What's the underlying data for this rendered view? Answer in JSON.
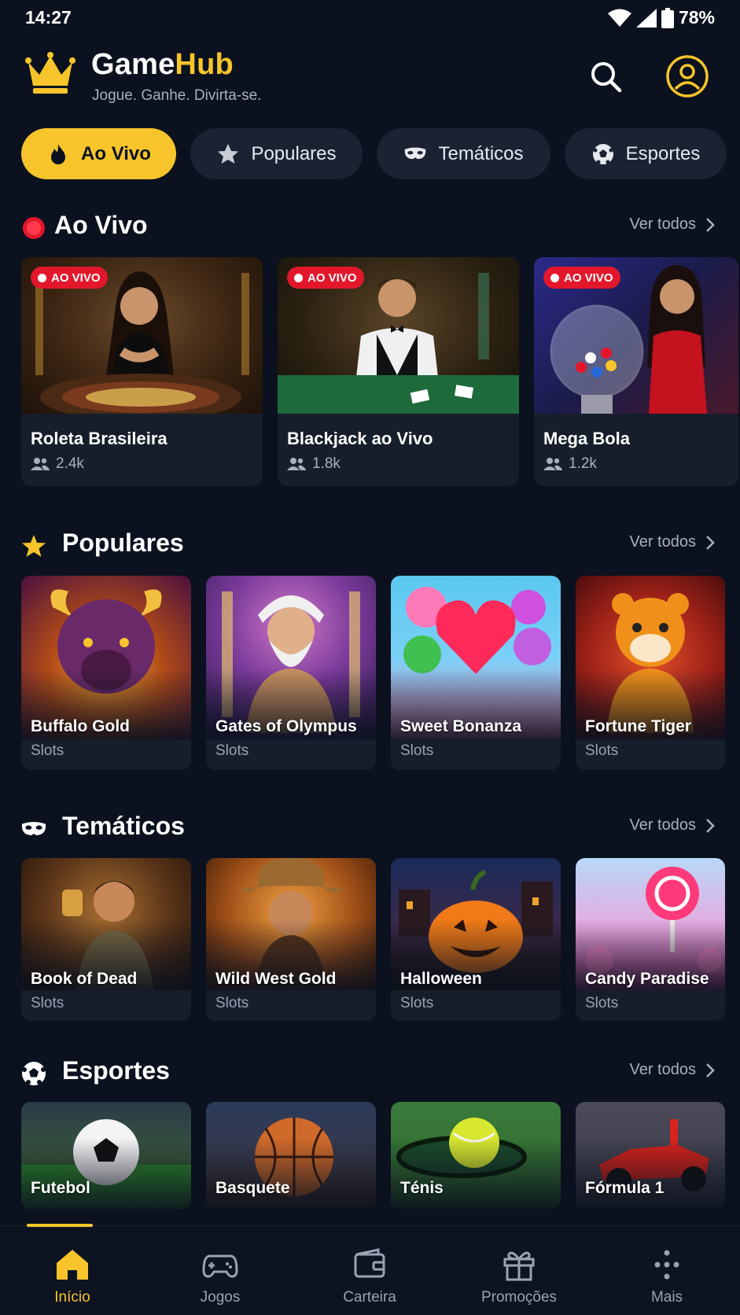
{
  "status": {
    "time": "14:27",
    "battery": "78%"
  },
  "header": {
    "brand_part1": "Game",
    "brand_part2": "Hub",
    "tagline": "Jogue. Ganhe. Divirta-se."
  },
  "tabs": [
    {
      "label": "Ao Vivo",
      "icon": "flame-icon",
      "active": true
    },
    {
      "label": "Populares",
      "icon": "star-icon",
      "active": false
    },
    {
      "label": "Temáticos",
      "icon": "mask-icon",
      "active": false
    },
    {
      "label": "Esportes",
      "icon": "soccer-ball-icon",
      "active": false
    }
  ],
  "see_all": "Ver todos",
  "live": {
    "title": "Ao Vivo",
    "badge": "AO VIVO",
    "items": [
      {
        "name": "Roleta Brasileira",
        "viewers": "2.4k"
      },
      {
        "name": "Blackjack ao Vivo",
        "viewers": "1.8k"
      },
      {
        "name": "Mega Bola",
        "viewers": "1.2k"
      }
    ]
  },
  "popular": {
    "title": "Populares",
    "items": [
      {
        "name": "Buffalo Gold",
        "category": "Slots"
      },
      {
        "name": "Gates of Olympus",
        "category": "Slots"
      },
      {
        "name": "Sweet Bonanza",
        "category": "Slots"
      },
      {
        "name": "Fortune Tiger",
        "category": "Slots"
      }
    ]
  },
  "themed": {
    "title": "Temáticos",
    "items": [
      {
        "name": "Book of Dead",
        "category": "Slots"
      },
      {
        "name": "Wild West Gold",
        "category": "Slots"
      },
      {
        "name": "Halloween",
        "category": "Slots"
      },
      {
        "name": "Candy Paradise",
        "category": "Slots"
      }
    ]
  },
  "sports": {
    "title": "Esportes",
    "items": [
      {
        "name": "Futebol"
      },
      {
        "name": "Basquete"
      },
      {
        "name": "Ténis"
      },
      {
        "name": "Fórmula 1"
      }
    ]
  },
  "nav": [
    {
      "label": "Início",
      "icon": "home-icon",
      "active": true
    },
    {
      "label": "Jogos",
      "icon": "gamepad-icon",
      "active": false
    },
    {
      "label": "Carteira",
      "icon": "wallet-icon",
      "active": false
    },
    {
      "label": "Promoções",
      "icon": "gift-icon",
      "active": false
    },
    {
      "label": "Mais",
      "icon": "more-dots-icon",
      "active": false
    }
  ],
  "colors": {
    "accent": "#f7c52b",
    "background": "#0b111e",
    "card": "#161d2b",
    "live_red": "#e3172c"
  }
}
